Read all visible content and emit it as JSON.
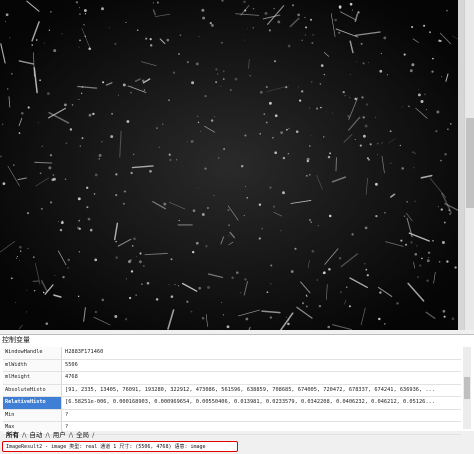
{
  "panel": {
    "title": "控制变量",
    "rows": [
      {
        "name": "WindowHandle",
        "value": "H2883F171460"
      },
      {
        "name": "mlWidth",
        "value": "5506"
      },
      {
        "name": "mlHeight",
        "value": "4768"
      },
      {
        "name": "AbsoluteHisto",
        "value": "[91, 2335, 13405, 76091, 193280, 322912, 473086, 561596, 638859, 708685, 674005, 720472, 678337, 674241, 636936, ..."
      },
      {
        "name": "RelativeHisto",
        "value": "[6.58251e-006, 0.000168903, 0.000969654, 0.00550406, 0.013981, 0.0233579, 0.0342208, 0.0406232, 0.046212, 0.05126..."
      },
      {
        "name": "Min",
        "value": "?"
      },
      {
        "name": "Max",
        "value": "?"
      }
    ]
  },
  "tabs": [
    "所有",
    "自动",
    "用户",
    "全局"
  ],
  "status": {
    "text": "ImageResult2 - image  类型: real 通道 1 尺寸: (5506, 4768) 语意: image"
  }
}
